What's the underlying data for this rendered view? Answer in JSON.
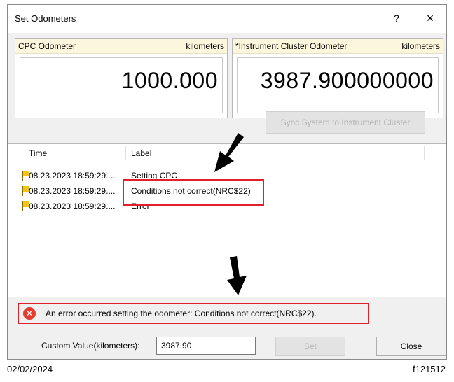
{
  "window": {
    "title": "Set Odometers",
    "help_glyph": "?",
    "close_glyph": "×"
  },
  "cpc": {
    "header_label": "CPC Odometer",
    "unit": "kilometers",
    "value": "1000.000"
  },
  "cluster": {
    "header_label": "*Instrument Cluster Odometer",
    "unit": "kilometers",
    "value": "3987.900000000"
  },
  "sync_button": "Sync System to Instrument Cluster",
  "log": {
    "columns": [
      "Time",
      "Label"
    ],
    "rows": [
      {
        "time": "08.23.2023 18:59:29....",
        "label": "Setting CPC"
      },
      {
        "time": "08.23.2023 18:59:29....",
        "label": "Conditions not correct(NRC$22)"
      },
      {
        "time": "08.23.2023 18:59:29....",
        "label": "Error"
      }
    ]
  },
  "status": {
    "message": "An error occurred setting the odometer: Conditions not correct(NRC$22)."
  },
  "custom": {
    "label": "Custom Value(kilometers):",
    "value": "3987.90"
  },
  "buttons": {
    "set": "Set",
    "close": "Close"
  },
  "footer": {
    "date": "02/02/2024",
    "code": "f121512"
  },
  "colors": {
    "highlight": "#e0202a",
    "header_bg": "#fcf6dd",
    "error_icon": "#e63b2e",
    "flag": "#f0c419"
  }
}
